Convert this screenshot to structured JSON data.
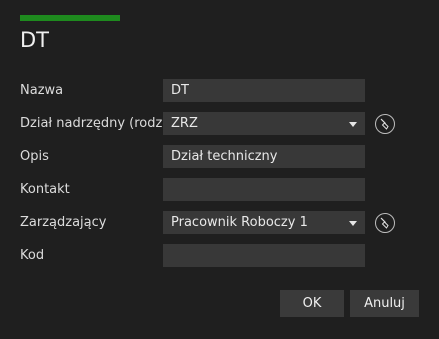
{
  "dialog": {
    "title": "DT"
  },
  "form": {
    "name": {
      "label": "Nazwa",
      "value": "DT"
    },
    "parent": {
      "label": "Dział nadrzędny (rodzic)",
      "value": "ZRZ"
    },
    "description": {
      "label": "Opis",
      "value": "Dział techniczny"
    },
    "contact": {
      "label": "Kontakt",
      "value": ""
    },
    "manager": {
      "label": "Zarządzający",
      "value": "Pracownik Roboczy 1"
    },
    "code": {
      "label": "Kod",
      "value": ""
    }
  },
  "buttons": {
    "ok": "OK",
    "cancel": "Anuluj"
  },
  "icons": {
    "clear": "broom-clear-icon",
    "dropdown": "chevron-down-icon"
  },
  "colors": {
    "accent": "#1e8a1e",
    "background": "#1f1f1f",
    "field": "#383838"
  }
}
